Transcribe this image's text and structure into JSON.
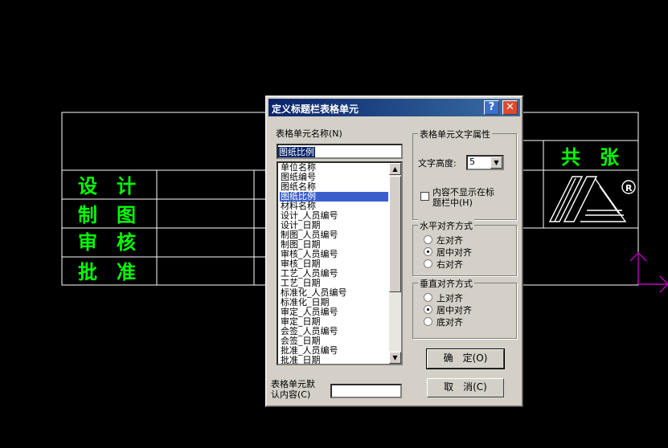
{
  "background_drawing": {
    "title_row_cells": [
      {
        "label": "共　张"
      }
    ],
    "left_labels": [
      "设　计",
      "制　图",
      "审　核",
      "批　准"
    ]
  },
  "dialog": {
    "title": "定义标题栏表格单元",
    "help_button": "?",
    "close_button": "✕",
    "cell_name_label": "表格单元名称(N)",
    "cell_name_value": "图纸比例",
    "list_items": [
      "单位名称",
      "图纸编号",
      "图纸名称",
      "图纸比例",
      "材料名称",
      "设计_人员编号",
      "设计_日期",
      "制图_人员编号",
      "制图_日期",
      "审核_人员编号",
      "审核_日期",
      "工艺_人员编号",
      "工艺_日期",
      "标准化_人员编号",
      "标准化_日期",
      "审定_人员编号",
      "审定_日期",
      "会签_人员编号",
      "会签_日期",
      "批准_人员编号",
      "批准_日期"
    ],
    "selected_item": "图纸比例",
    "default_content_label_line1": "表格单元默",
    "default_content_label_line2": "认内容(C)",
    "default_content_value": "",
    "text_props": {
      "group_title": "表格单元文字属性",
      "height_label": "文字高度:",
      "height_value": "5",
      "hide_label_line1": "内容不显示在标",
      "hide_label_line2": "题栏中(H)",
      "hide_checked": false
    },
    "h_align": {
      "group_title": "水平对齐方式",
      "options": [
        "左对齐",
        "居中对齐",
        "右对齐"
      ],
      "selected": "居中对齐"
    },
    "v_align": {
      "group_title": "垂直对齐方式",
      "options": [
        "上对齐",
        "居中对齐",
        "底对齐"
      ],
      "selected": "居中对齐"
    },
    "ok_label": "确　定(O)",
    "cancel_label": "取　消(C)"
  },
  "colors": {
    "cad_text": "#00ff00",
    "cad_line": "#ffffff",
    "ucs_icon": "#c000c0",
    "title_gradient_start": "#0a246a",
    "title_gradient_end": "#3a6ea5"
  }
}
